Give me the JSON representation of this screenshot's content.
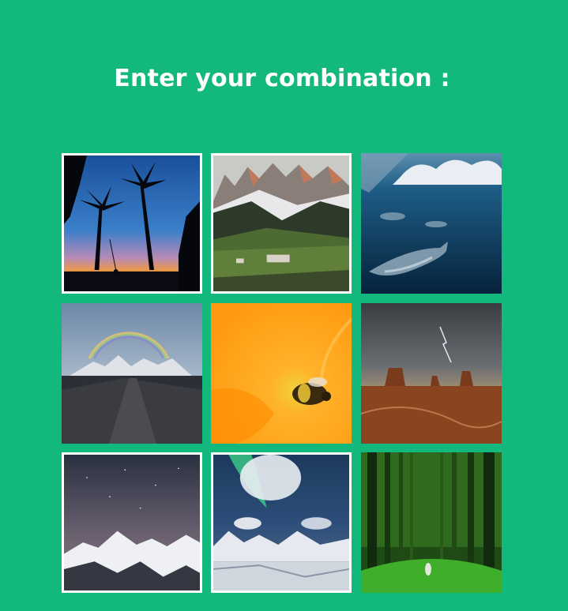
{
  "page": {
    "title": "Enter your combination :",
    "background_color": "#13b87c"
  },
  "tiles": [
    {
      "subject": "palm-trees-sunset-swing",
      "selected": true
    },
    {
      "subject": "mountain-valley-village",
      "selected": true
    },
    {
      "subject": "dolphins-underwater",
      "selected": false
    },
    {
      "subject": "rainbow-over-mountains",
      "selected": false
    },
    {
      "subject": "bee-on-orange-flower",
      "selected": false
    },
    {
      "subject": "desert-buttes-lightning",
      "selected": false
    },
    {
      "subject": "snowy-peaks-night-sky",
      "selected": true
    },
    {
      "subject": "aurora-over-snowy-mountains",
      "selected": true
    },
    {
      "subject": "green-forest-person",
      "selected": false
    }
  ]
}
